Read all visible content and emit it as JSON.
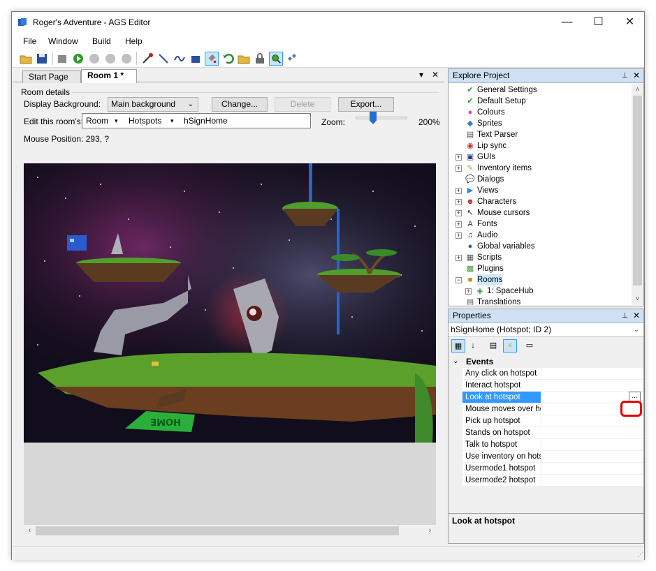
{
  "window": {
    "title": "Roger's Adventure - AGS Editor",
    "controls": {
      "minimize": "—",
      "maximize": "☐",
      "close": "✕"
    }
  },
  "menu": [
    "File",
    "Window",
    "Build",
    "Help"
  ],
  "toolbar_icons": [
    "open-icon",
    "save-icon",
    "build-icon",
    "run-icon",
    "pause-icon",
    "stop-debug-icon",
    "step-icon",
    "pick-color-icon",
    "line-draw-icon",
    "freehand-icon",
    "rectangle-fill-icon",
    "fill-bucket-icon",
    "undo-icon",
    "open-folder-icon",
    "lock-icon",
    "zoom-icon",
    "eye-icon"
  ],
  "tabs": {
    "start_page": "Start Page",
    "room": "Room 1 *",
    "dropdown": "▾",
    "close": "✕"
  },
  "room_details": {
    "group_label": "Room details",
    "display_background_label": "Display Background:",
    "display_background_value": "Main background",
    "change_button": "Change...",
    "delete_button": "Delete",
    "export_button": "Export...",
    "edit_label": "Edit this room's:",
    "edit_layer": "Room",
    "edit_type": "Hotspots",
    "edit_item": "hSignHome",
    "zoom_label": "Zoom:",
    "zoom_value": "200%",
    "zoom_fraction": 0.3,
    "mouse_position": "Mouse Position: 293, ?",
    "sign_text": "HOME"
  },
  "explore": {
    "title": "Explore Project",
    "pin": "📌",
    "close": "✕",
    "items": [
      {
        "label": "General Settings",
        "icon": "✔",
        "color": "#2a9d2a",
        "indent": 0,
        "expandable": false
      },
      {
        "label": "Default Setup",
        "icon": "✔",
        "color": "#2a9d2a",
        "indent": 0,
        "expandable": false
      },
      {
        "label": "Colours",
        "icon": "●",
        "color": "#d04a9a",
        "indent": 0,
        "expandable": false
      },
      {
        "label": "Sprites",
        "icon": "◆",
        "color": "#2c7fd0",
        "indent": 0,
        "expandable": false
      },
      {
        "label": "Text Parser",
        "icon": "▤",
        "color": "#555555",
        "indent": 0,
        "expandable": false
      },
      {
        "label": "Lip sync",
        "icon": "◉",
        "color": "#c0302c",
        "indent": 0,
        "expandable": false
      },
      {
        "label": "GUIs",
        "icon": "▣",
        "color": "#303a8c",
        "indent": 0,
        "expandable": true
      },
      {
        "label": "Inventory items",
        "icon": "✎",
        "color": "#c6a13a",
        "indent": 0,
        "expandable": true
      },
      {
        "label": "Dialogs",
        "icon": "💬",
        "color": "#4a7ad0",
        "indent": 0,
        "expandable": false
      },
      {
        "label": "Views",
        "icon": "▶",
        "color": "#2a8fd0",
        "indent": 0,
        "expandable": true
      },
      {
        "label": "Characters",
        "icon": "☻",
        "color": "#c0302c",
        "indent": 0,
        "expandable": true
      },
      {
        "label": "Mouse cursors",
        "icon": "↖",
        "color": "#333333",
        "indent": 0,
        "expandable": true
      },
      {
        "label": "Fonts",
        "icon": "A",
        "color": "#333333",
        "indent": 0,
        "expandable": true
      },
      {
        "label": "Audio",
        "icon": "♫",
        "color": "#333333",
        "indent": 0,
        "expandable": true
      },
      {
        "label": "Global variables",
        "icon": "●",
        "color": "#2a5fa0",
        "indent": 0,
        "expandable": false
      },
      {
        "label": "Scripts",
        "icon": "▦",
        "color": "#555555",
        "indent": 0,
        "expandable": true
      },
      {
        "label": "Plugins",
        "icon": "▩",
        "color": "#4a9a3a",
        "indent": 0,
        "expandable": false
      },
      {
        "label": "Rooms",
        "icon": "■",
        "color": "#c88a2a",
        "indent": 0,
        "expandable": true,
        "expanded": true,
        "selected": true
      },
      {
        "label": "1: SpaceHub",
        "icon": "◈",
        "color": "#3a8a3a",
        "indent": 1,
        "expandable": true
      },
      {
        "label": "Translations",
        "icon": "▤",
        "color": "#555555",
        "indent": 0,
        "expandable": false
      }
    ]
  },
  "properties": {
    "title": "Properties",
    "pin": "📌",
    "close": "✕",
    "object": "hSignHome (Hotspot; ID 2)",
    "category": "Events",
    "rows": [
      {
        "name": "Any click on hotspot",
        "value": ""
      },
      {
        "name": "Interact hotspot",
        "value": ""
      },
      {
        "name": "Look at hotspot",
        "value": "",
        "selected": true
      },
      {
        "name": "Mouse moves over hot",
        "value": ""
      },
      {
        "name": "Pick up hotspot",
        "value": ""
      },
      {
        "name": "Stands on hotspot",
        "value": ""
      },
      {
        "name": "Talk to hotspot",
        "value": ""
      },
      {
        "name": "Use inventory on hotsp",
        "value": ""
      },
      {
        "name": "Usermode1 hotspot",
        "value": ""
      },
      {
        "name": "Usermode2 hotspot",
        "value": ""
      }
    ],
    "ellipsis": "...",
    "description_title": "Look at hotspot"
  },
  "colors": {
    "selection": "#3399ff",
    "panel_header": "#cfe0f4",
    "highlight_ring": "#e00000"
  }
}
